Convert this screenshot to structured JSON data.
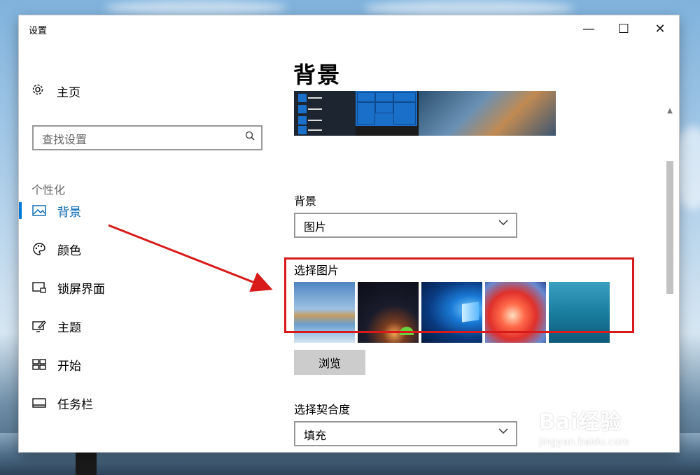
{
  "window": {
    "title": "设置",
    "minimize": "—",
    "maximize": "☐",
    "close": "✕"
  },
  "sidebar": {
    "home": {
      "icon": "gear-icon",
      "label": "主页"
    },
    "search": {
      "placeholder": "查找设置",
      "icon": "search-icon"
    },
    "section_title": "个性化",
    "items": [
      {
        "label": "背景",
        "icon": "image-icon",
        "active": true
      },
      {
        "label": "颜色",
        "icon": "palette-icon",
        "active": false
      },
      {
        "label": "锁屏界面",
        "icon": "lock-screen-icon",
        "active": false
      },
      {
        "label": "主题",
        "icon": "theme-icon",
        "active": false
      },
      {
        "label": "开始",
        "icon": "start-icon",
        "active": false
      },
      {
        "label": "任务栏",
        "icon": "taskbar-icon",
        "active": false
      }
    ]
  },
  "main": {
    "title": "背景",
    "background_label": "背景",
    "background_value": "图片",
    "choose_picture_label": "选择图片",
    "browse_label": "浏览",
    "fit_label": "选择契合度",
    "fit_value": "填充"
  },
  "watermark": {
    "main": "Bai经验",
    "sub": "jingyan.baidu.com"
  },
  "colors": {
    "accent": "#0078d7",
    "highlight": "#d91a1a"
  }
}
